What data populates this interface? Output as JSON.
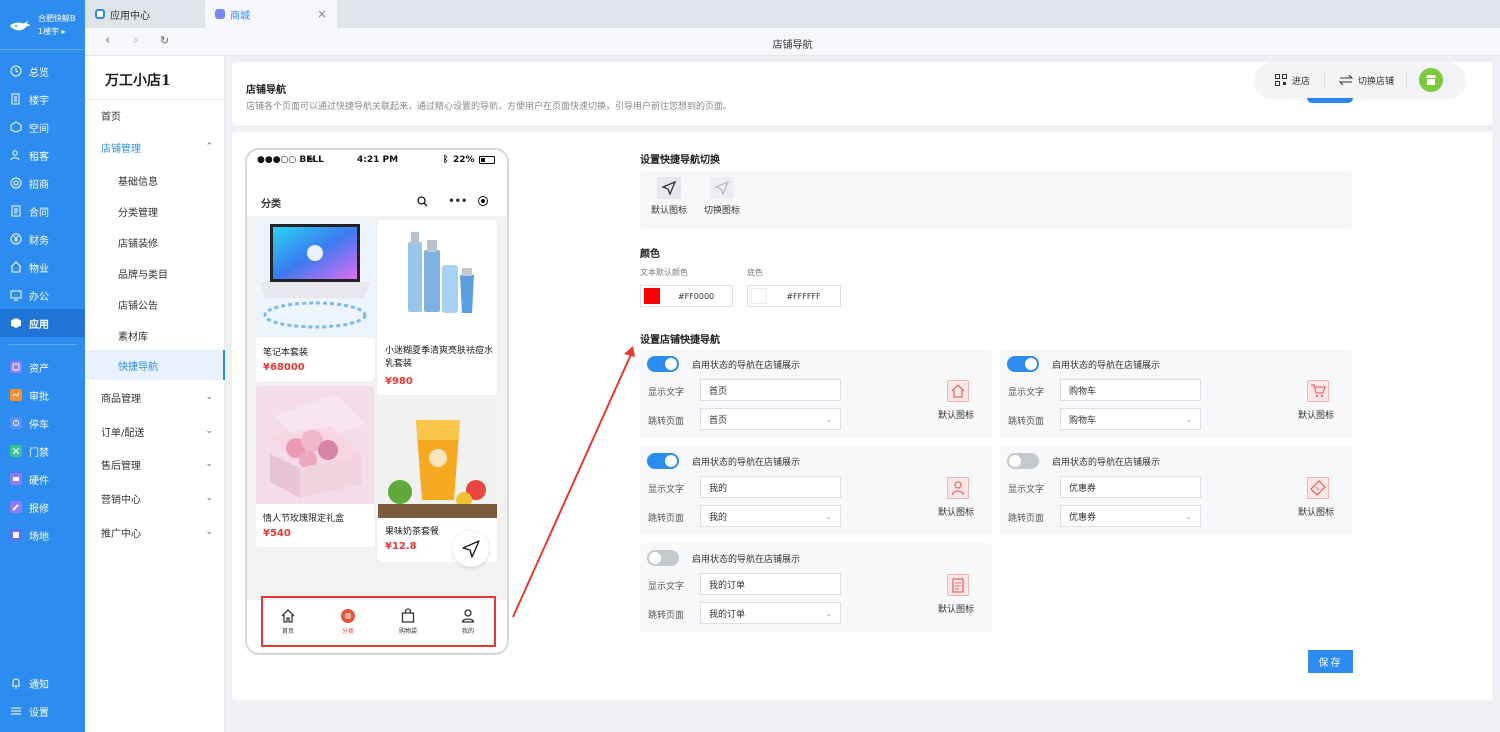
{
  "brand": {
    "line1": "合肥快鲸B",
    "line2": "1楼宇"
  },
  "sidebar": {
    "items": [
      {
        "label": "总览",
        "icon": "clock-icon"
      },
      {
        "label": "楼宇",
        "icon": "building-icon"
      },
      {
        "label": "空间",
        "icon": "cube-icon"
      },
      {
        "label": "租客",
        "icon": "users-icon"
      },
      {
        "label": "招商",
        "icon": "target-icon"
      },
      {
        "label": "合同",
        "icon": "document-icon"
      },
      {
        "label": "财务",
        "icon": "yen-icon"
      },
      {
        "label": "物业",
        "icon": "home-icon"
      },
      {
        "label": "办公",
        "icon": "monitor-icon"
      },
      {
        "label": "应用",
        "icon": "app-icon"
      }
    ],
    "apps": [
      {
        "label": "资产",
        "color": "#8e7cf5"
      },
      {
        "label": "审批",
        "color": "#f5902f"
      },
      {
        "label": "停车",
        "color": "#5b8ff9"
      },
      {
        "label": "门禁",
        "color": "#35c38f"
      },
      {
        "label": "硬件",
        "color": "#8e7cf5"
      },
      {
        "label": "报修",
        "color": "#8e7cf5"
      },
      {
        "label": "场地",
        "color": "#5b6ff9"
      }
    ],
    "bottom": [
      {
        "label": "通知",
        "icon": "bell-icon"
      },
      {
        "label": "设置",
        "icon": "menu-icon"
      }
    ]
  },
  "tabs": [
    {
      "label": "应用中心"
    },
    {
      "label": "商城"
    }
  ],
  "address": {
    "title": "店铺导航"
  },
  "side2": {
    "shop_name": "万工小店1",
    "home": "首页",
    "group": "店铺管理",
    "sub": [
      "基础信息",
      "分类管理",
      "店铺装修",
      "品牌与类目",
      "店铺公告",
      "素材库",
      "快捷导航"
    ],
    "groups": [
      "商品管理",
      "订单/配送",
      "售后管理",
      "营销中心",
      "推广中心"
    ]
  },
  "header": {
    "title": "店铺导航",
    "desc": "店铺各个页面可以通过快捷导航关联起来，通过精心设置的导航，方便用户在页面快速切换，引导用户前往您想到的页面。",
    "enter_store": "进店",
    "switch_store": "切换店铺"
  },
  "phone": {
    "carrier": "●●●○○ BELL",
    "time": "4:21 PM",
    "battery": "22%",
    "page_title": "分类",
    "products": [
      {
        "name": "笔记本套装",
        "price": "¥68000"
      },
      {
        "name": "小迷糊夏季清爽亮肤祛痘水乳套装",
        "price": "¥980"
      },
      {
        "name": "情人节玫瑰限定礼盒",
        "price": "¥540"
      },
      {
        "name": "果味奶茶套餐",
        "price": "¥12.8"
      }
    ],
    "tabbar": [
      "首页",
      "分类",
      "购物袋",
      "我的"
    ]
  },
  "settings": {
    "switch_title": "设置快捷导航切换",
    "default_icon_label": "默认图标",
    "switch_icon_label": "切换图标",
    "color_title": "颜色",
    "text_color_label": "文本默认颜色",
    "bg_color_label": "底色",
    "text_color": "#FF0000",
    "bg_color": "#FFFFFF",
    "nav_title": "设置店铺快捷导航",
    "toggle_text": "启用状态的导航在店铺展示",
    "display_text_label": "显示文字",
    "jump_page_label": "跳转页面",
    "default_icon": "默认图标",
    "cards": [
      {
        "enabled": true,
        "text": "首页",
        "page": "首页",
        "icon": "home-icon"
      },
      {
        "enabled": true,
        "text": "购物车",
        "page": "购物车",
        "icon": "cart-icon"
      },
      {
        "enabled": true,
        "text": "我的",
        "page": "我的",
        "icon": "user-icon"
      },
      {
        "enabled": false,
        "text": "优惠券",
        "page": "优惠券",
        "icon": "coupon-icon"
      },
      {
        "enabled": false,
        "text": "我的订单",
        "page": "我的订单",
        "icon": "order-icon"
      }
    ],
    "save": "保存"
  }
}
